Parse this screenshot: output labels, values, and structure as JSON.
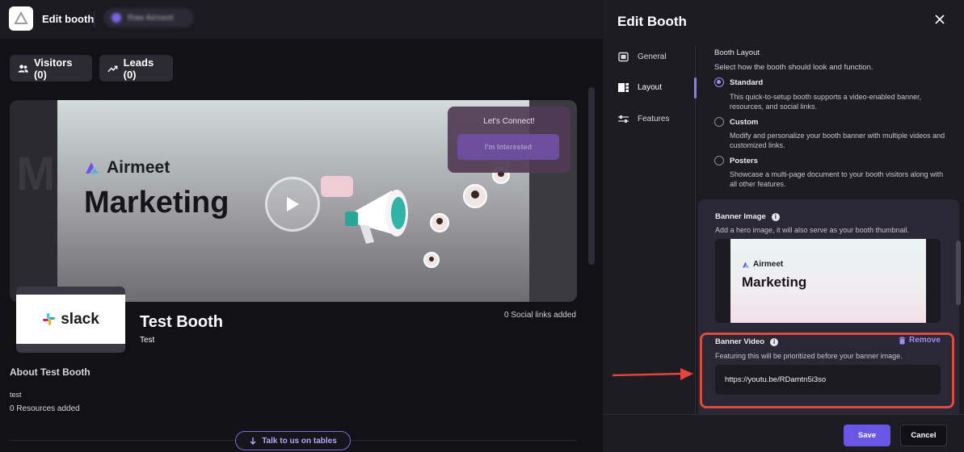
{
  "topbar": {
    "title": "Edit booth",
    "chip_text": "Raw Airmeet"
  },
  "actions": {
    "visitors": "Visitors (0)",
    "leads": "Leads (0)"
  },
  "banner": {
    "ghost_letter": "M",
    "brand": "Airmeet",
    "headline": "Marketing",
    "connect_title": "Let's Connect!",
    "connect_button": "I'm Interested"
  },
  "booth": {
    "logo_text": "slack",
    "name": "Test Booth",
    "subtitle": "Test",
    "social_links": "0 Social links added",
    "about_title": "About Test Booth",
    "about_desc": "test",
    "resources": "0 Resources added",
    "talk_button": "Talk to us on tables"
  },
  "panel": {
    "title": "Edit Booth",
    "nav": [
      {
        "label": "General",
        "icon": "general-icon"
      },
      {
        "label": "Layout",
        "icon": "layout-icon"
      },
      {
        "label": "Features",
        "icon": "sliders-icon"
      }
    ],
    "layout_section": {
      "label": "Booth Layout",
      "desc": "Select how the booth should look and function.",
      "options": [
        {
          "title": "Standard",
          "desc": "This quick-to-setup booth supports a video-enabled banner, resources, and social links.",
          "selected": true
        },
        {
          "title": "Custom",
          "desc": "Modify and personalize your booth banner with multiple videos and customized links.",
          "selected": false
        },
        {
          "title": "Posters",
          "desc": "Showcase a multi-page document to your booth visitors along with all other features.",
          "selected": false
        }
      ]
    },
    "banner_image": {
      "label": "Banner Image",
      "desc": "Add a hero image, it will also serve as your booth thumbnail.",
      "thumb_brand": "Airmeet",
      "thumb_title": "Marketing"
    },
    "banner_video": {
      "label": "Banner Video",
      "remove": "Remove",
      "desc": "Featuring this will be prioritized before your banner image.",
      "value": "https://youtu.be/RDamtn5i3so"
    },
    "footer": {
      "save": "Save",
      "cancel": "Cancel"
    }
  },
  "colors": {
    "accent": "#6a55e6",
    "highlight": "#d94b43",
    "panel_bg": "#1d1c23",
    "page_bg": "#121116"
  }
}
